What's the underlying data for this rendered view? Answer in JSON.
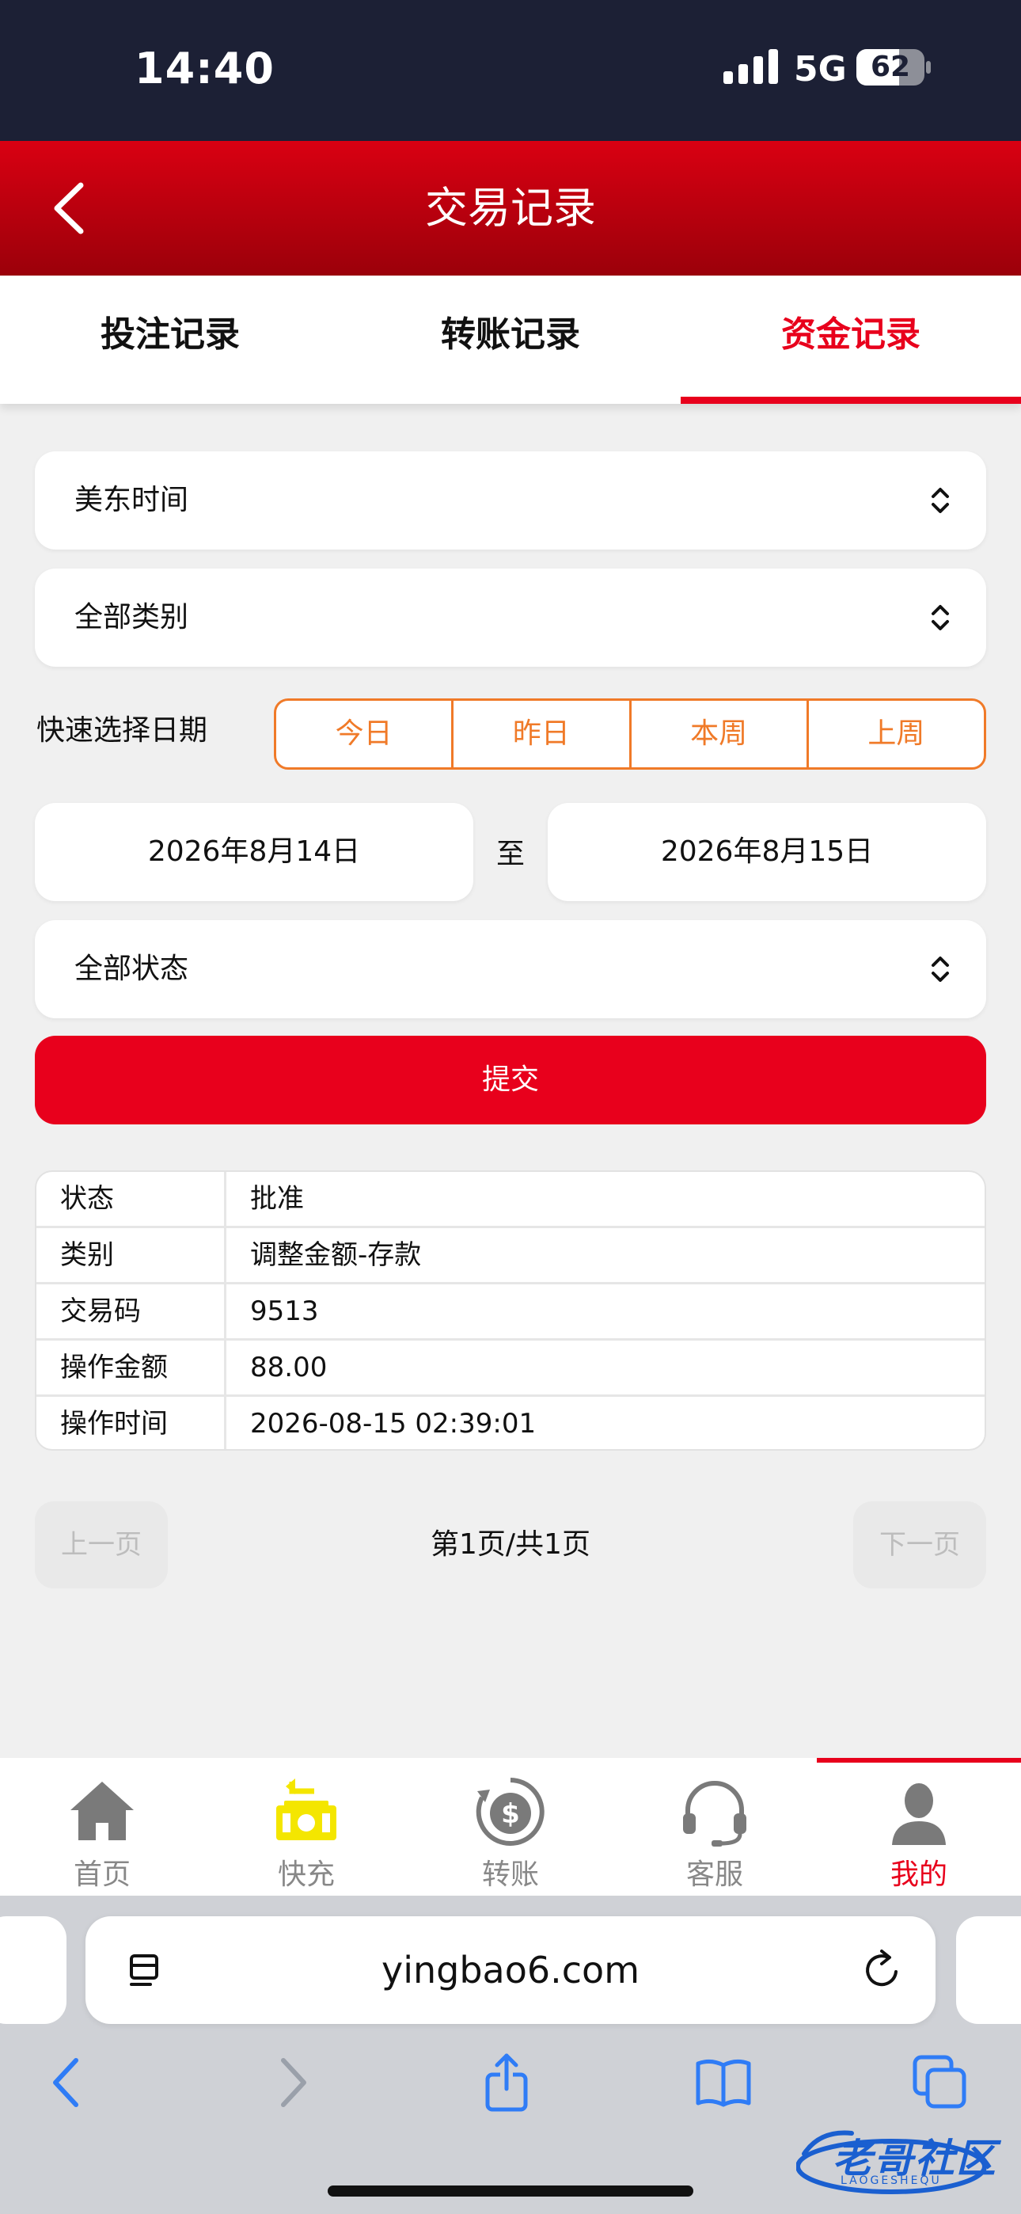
{
  "status_bar": {
    "time": "14:40",
    "network": "5G",
    "battery": "62"
  },
  "header": {
    "title": "交易记录"
  },
  "tabs": [
    {
      "label": "投注记录",
      "active": false
    },
    {
      "label": "转账记录",
      "active": false
    },
    {
      "label": "资金记录",
      "active": true
    }
  ],
  "filters": {
    "timezone": "美东时间",
    "category": "全部类别",
    "quick_label": "快速选择日期",
    "quick_options": [
      "今日",
      "昨日",
      "本周",
      "上周"
    ],
    "date_from": "2026年8月14日",
    "date_sep": "至",
    "date_to": "2026年8月15日",
    "status": "全部状态",
    "submit_label": "提交"
  },
  "record": [
    {
      "key": "状态",
      "value": "批准"
    },
    {
      "key": "类别",
      "value": "调整金额-存款"
    },
    {
      "key": "交易码",
      "value": "9513"
    },
    {
      "key": "操作金额",
      "value": "88.00"
    },
    {
      "key": "操作时间",
      "value": "2026-08-15 02:39:01"
    }
  ],
  "pagination": {
    "prev_label": "上一页",
    "info": "第1页/共1页",
    "next_label": "下一页"
  },
  "bottom_nav": [
    {
      "label": "首页",
      "icon": "home-icon",
      "active": false
    },
    {
      "label": "快充",
      "icon": "quick-charge-icon",
      "active": false
    },
    {
      "label": "转账",
      "icon": "transfer-icon",
      "active": false
    },
    {
      "label": "客服",
      "icon": "headset-icon",
      "active": false
    },
    {
      "label": "我的",
      "icon": "user-icon",
      "active": true
    }
  ],
  "browser": {
    "url": "yingbao6.com"
  },
  "watermark": {
    "text": "老哥社区",
    "sub": "LAOGESHEQU"
  },
  "colors": {
    "accent": "#e8001c",
    "quick": "#f07a28",
    "status_bar": "#1c2035",
    "quick_charge_icon": "#f4e600"
  }
}
